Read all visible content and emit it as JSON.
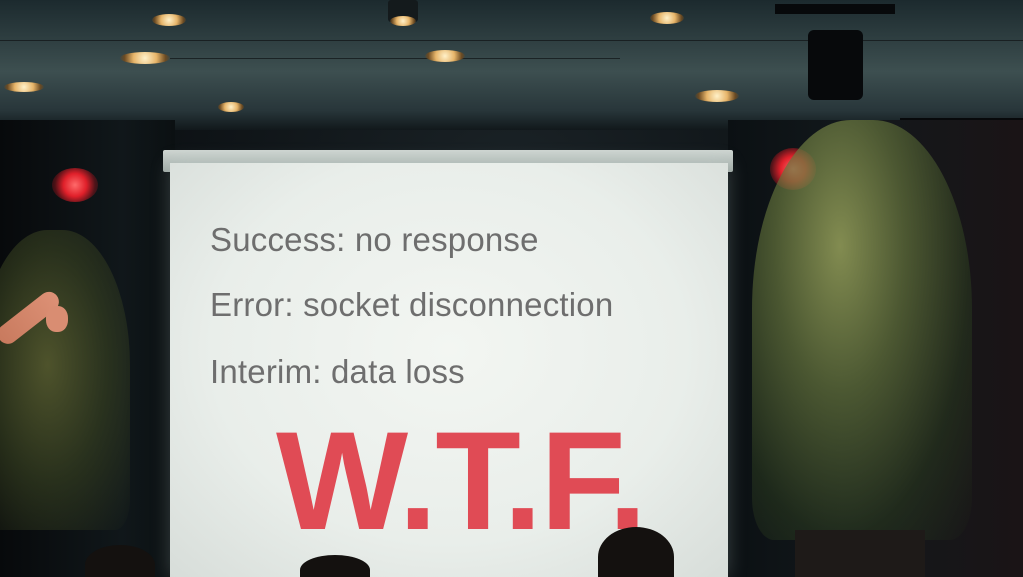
{
  "slide": {
    "lines": [
      "Success: no response",
      "Error: socket disconnection",
      "Interim: data loss"
    ],
    "headline": "W.T.F."
  },
  "colors": {
    "headline": "#e04b55",
    "body_text": "#6e6e6e",
    "screen": "#eef2ee"
  }
}
